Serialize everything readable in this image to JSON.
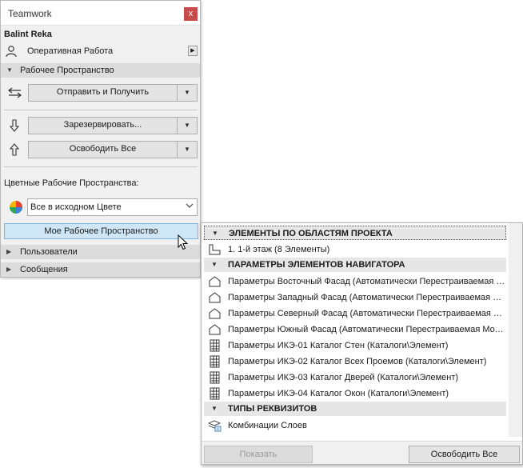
{
  "palette": {
    "title": "Teamwork",
    "close_glyph": "x",
    "user_name": "Balint Reka",
    "mode_label": "Оперативная Работа",
    "workspace_section": "Рабочее Пространство",
    "send_receive": "Отправить и Получить",
    "reserve": "Зарезервировать...",
    "release_all": "Освободить Все",
    "colors_label": "Цветные Рабочие Пространства:",
    "color_select_value": "Все в исходном Цвете",
    "my_workspace_button": "Мое Рабочее Пространство",
    "users_section": "Пользователи",
    "messages_section": "Сообщения"
  },
  "panel": {
    "groups": [
      {
        "label": "ЭЛЕМЕНТЫ ПО ОБЛАСТЯМ ПРОЕКТА",
        "items": [
          {
            "label": "1. 1-й этаж (8 Элементы)",
            "icon": "story-icon"
          }
        ]
      },
      {
        "label": "ПАРАМЕТРЫ ЭЛЕМЕНТОВ НАВИГАТОРА",
        "items": [
          {
            "label": "Параметры Восточный Фасад (Автоматически Перестраиваемая Модель)",
            "icon": "elevation-icon"
          },
          {
            "label": "Параметры Западный Фасад (Автоматически Перестраиваемая Модель)",
            "icon": "elevation-icon"
          },
          {
            "label": "Параметры Северный Фасад (Автоматически Перестраиваемая Модель)",
            "icon": "elevation-icon"
          },
          {
            "label": "Параметры Южный Фасад (Автоматически Перестраиваемая Модель)",
            "icon": "elevation-icon"
          },
          {
            "label": "Параметры ИКЭ-01 Каталог Стен (Каталоги\\Элемент)",
            "icon": "schedule-icon"
          },
          {
            "label": "Параметры ИКЭ-02 Каталог Всех Проемов (Каталоги\\Элемент)",
            "icon": "schedule-icon"
          },
          {
            "label": "Параметры ИКЭ-03 Каталог Дверей (Каталоги\\Элемент)",
            "icon": "schedule-icon"
          },
          {
            "label": "Параметры ИКЭ-04 Каталог Окон (Каталоги\\Элемент)",
            "icon": "schedule-icon"
          }
        ]
      },
      {
        "label": "ТИПЫ РЕКВИЗИТОВ",
        "items": [
          {
            "label": "Комбинации Слоев",
            "icon": "layer-combination-icon"
          }
        ]
      }
    ],
    "show_button": "Показать",
    "release_all_button": "Освободить Все"
  },
  "colors": {
    "selection_fill": "#cfe6f7",
    "selection_border": "#7fb4e0",
    "close_red": "#c74b4b"
  }
}
